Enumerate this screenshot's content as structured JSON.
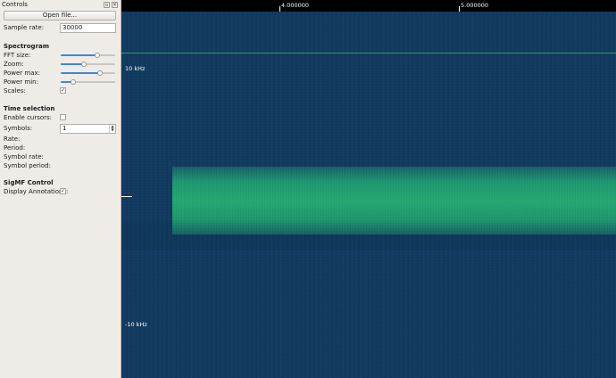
{
  "dock": {
    "title": "Controls",
    "open_file_label": "Open file...",
    "sample_rate": {
      "label": "Sample rate:",
      "value": "30000"
    }
  },
  "spectrogram": {
    "heading": "Spectrogram",
    "fft_size": {
      "label": "FFT size:",
      "level": 0.67
    },
    "zoom": {
      "label": "Zoom:",
      "level": 0.42
    },
    "power_max": {
      "label": "Power max:",
      "level": 0.72
    },
    "power_min": {
      "label": "Power min:",
      "level": 0.23
    },
    "scales": {
      "label": "Scales:",
      "checked": true
    }
  },
  "time_selection": {
    "heading": "Time selection",
    "enable_cursors": {
      "label": "Enable cursors:",
      "checked": false
    },
    "symbols": {
      "label": "Symbols:",
      "value": "1"
    },
    "rate_label": "Rate:",
    "period_label": "Period:",
    "symbol_rate_label": "Symbol rate:",
    "symbol_period_label": "Symbol period:"
  },
  "sigmf": {
    "heading": "SigMF Control",
    "display_annotations": {
      "label": "Display Annotations:",
      "checked": true
    }
  },
  "plot": {
    "time_ticks": [
      "4.000000",
      "5.000000"
    ],
    "freq_labels": {
      "top": "10 kHz",
      "bottom": "-10 kHz"
    },
    "colors": {
      "background": "#10345a",
      "signal": "#22a06c",
      "marker_line": "#3aa36a"
    }
  }
}
